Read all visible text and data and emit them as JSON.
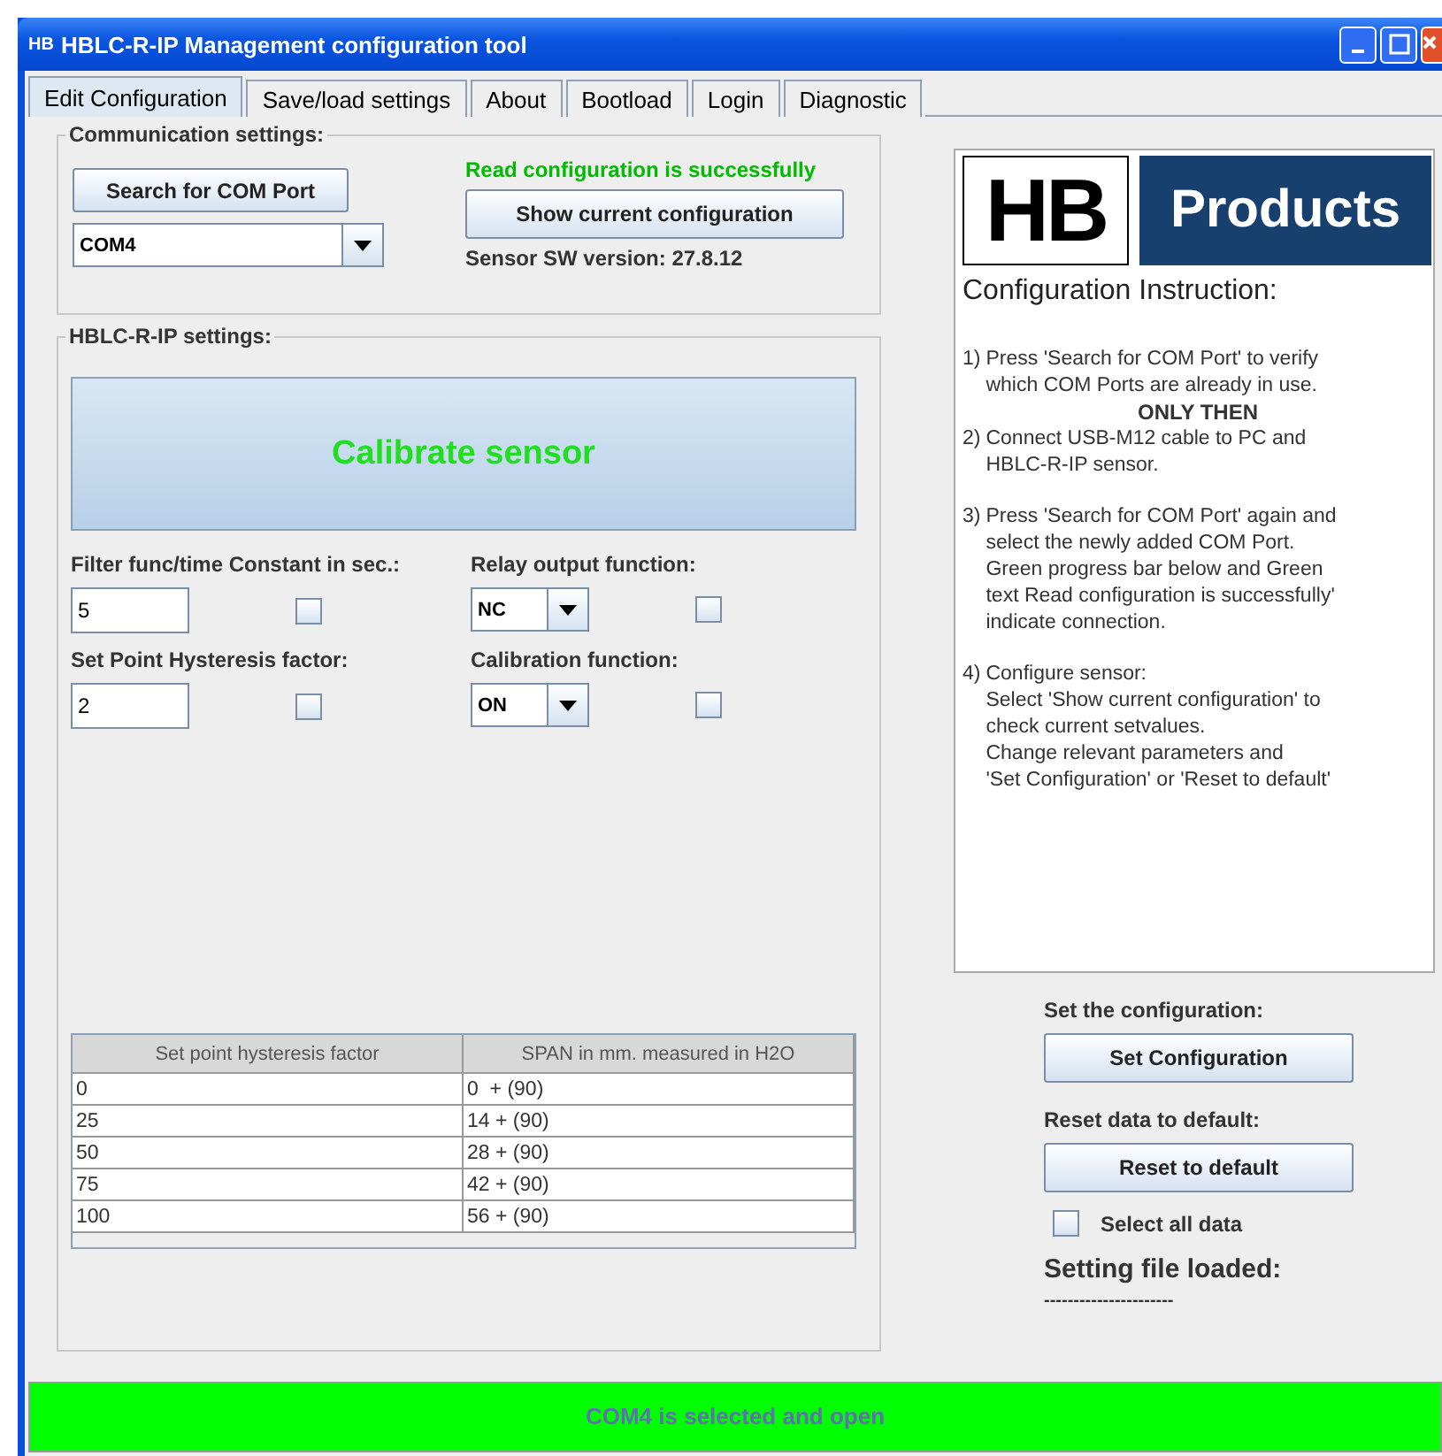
{
  "window": {
    "title": "HBLC-R-IP Management configuration tool",
    "app_badge": "HB"
  },
  "tabs": [
    {
      "label": "Edit Configuration",
      "selected": true
    },
    {
      "label": "Save/load settings",
      "selected": false
    },
    {
      "label": "About",
      "selected": false
    },
    {
      "label": "Bootload",
      "selected": false
    },
    {
      "label": "Login",
      "selected": false
    },
    {
      "label": "Diagnostic",
      "selected": false
    }
  ],
  "communication": {
    "title": "Communication settings:",
    "search_button": "Search for COM Port",
    "port": "COM4",
    "status": "Read configuration is successfully",
    "show_button": "Show current configuration",
    "version": "Sensor SW version: 27.8.12"
  },
  "settings": {
    "title": "HBLC-R-IP settings:",
    "calibrate_button": "Calibrate sensor",
    "fields": [
      {
        "label": "Filter func/time Constant in sec.:",
        "kind": "text",
        "value": "5",
        "checked": false
      },
      {
        "label": "Relay output function:",
        "kind": "combo",
        "value": "NC",
        "checked": false
      },
      {
        "label": "Set Point Hysteresis factor:",
        "kind": "text",
        "value": "2",
        "checked": false
      },
      {
        "label": "Calibration function:",
        "kind": "combo",
        "value": "ON",
        "checked": false
      }
    ],
    "table": {
      "columns": [
        "Set point hysteresis factor",
        "SPAN in mm. measured in H2O"
      ],
      "rows": [
        [
          "0",
          "0  + (90)"
        ],
        [
          "25",
          "14 + (90)"
        ],
        [
          "50",
          "28 + (90)"
        ],
        [
          "75",
          "42 + (90)"
        ],
        [
          "100",
          "56 + (90)"
        ]
      ]
    }
  },
  "instructions": {
    "logo_left": "HB",
    "logo_right": "Products",
    "heading": "Configuration Instruction:",
    "items": [
      {
        "kind": "step",
        "marker": "1)",
        "lines": [
          "Press 'Search for COM Port' to verify",
          "which COM Ports are already in use."
        ]
      },
      {
        "kind": "note",
        "text": "ONLY THEN"
      },
      {
        "kind": "step",
        "marker": "2)",
        "lines": [
          "Connect USB-M12 cable to PC and",
          "HBLC-R-IP sensor."
        ]
      },
      {
        "kind": "step",
        "marker": "3)",
        "lines": [
          "Press 'Search for COM Port' again and",
          "select the newly added COM Port.",
          "Green progress bar below and Green",
          "text Read configuration is successfully'",
          "indicate connection."
        ]
      },
      {
        "kind": "step",
        "marker": "4)",
        "lines": [
          "Configure sensor:",
          "Select 'Show current configuration' to",
          "check current setvalues.",
          "Change relevant parameters and",
          "'Set Configuration' or 'Reset to default'"
        ]
      }
    ]
  },
  "actions": {
    "set_label": "Set the configuration:",
    "set_button": "Set Configuration",
    "reset_label": "Reset data to default:",
    "reset_button": "Reset to default",
    "select_all": {
      "label": "Select all data",
      "checked": false
    },
    "file_label": "Setting file loaded:",
    "file_value": "----------------------"
  },
  "status_bar": {
    "text": "COM4 is selected and open",
    "level": 1
  }
}
